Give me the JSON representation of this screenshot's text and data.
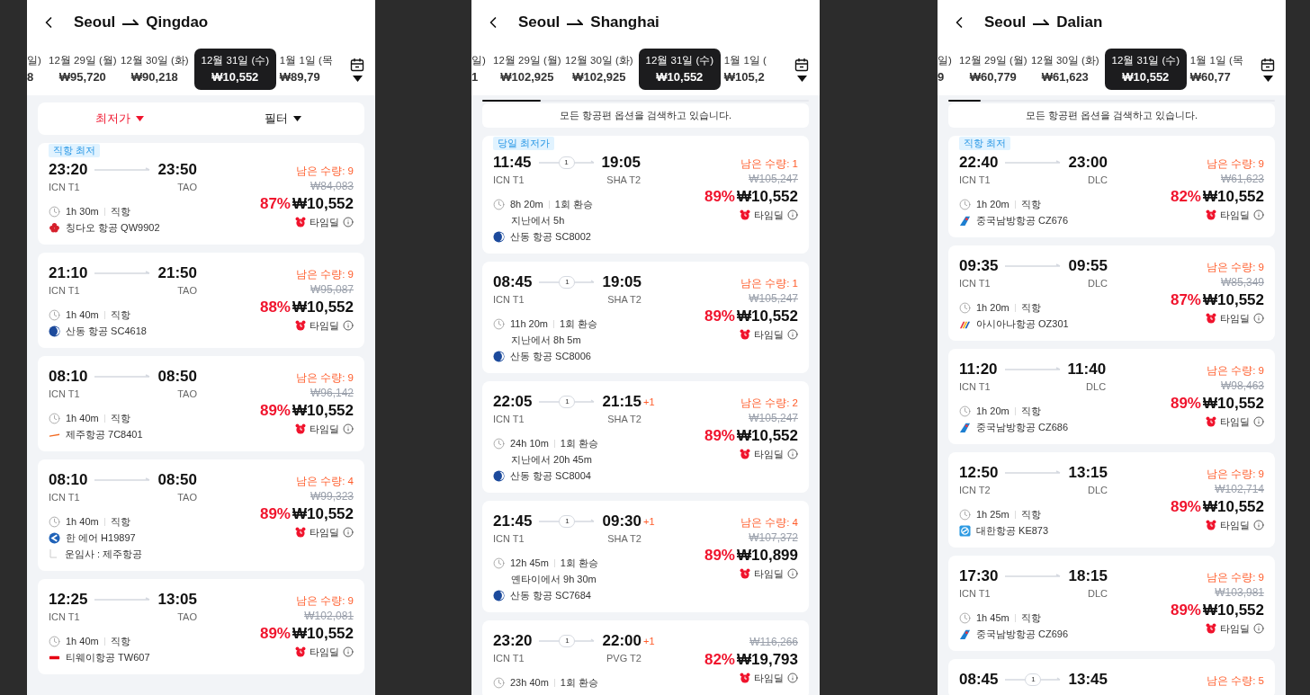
{
  "panels": [
    {
      "title": {
        "from": "Seoul",
        "to": "Qingdao"
      },
      "dates": [
        {
          "day": "일)",
          "price": "8",
          "selected": false
        },
        {
          "day": "12월 29일 (월)",
          "price": "₩95,720",
          "selected": false
        },
        {
          "day": "12월 30일 (화)",
          "price": "₩90,218",
          "selected": false
        },
        {
          "day": "12월 31일 (수)",
          "price": "₩10,552",
          "selected": true
        },
        {
          "day": "1월 1일 (목",
          "price": "₩89,79",
          "selected": false
        }
      ],
      "sort_bar": [
        {
          "label": "최저가",
          "active": true
        },
        {
          "label": "필터",
          "active": false
        }
      ],
      "flights": [
        {
          "badge": "직항 최저",
          "depart": "23:20",
          "arrive": "23:50",
          "from": "ICN T1",
          "to": "TAO",
          "duration": "1h 30m",
          "type": "직항",
          "logo": {
            "kind": "flower"
          },
          "airline": "칭다오 항공 QW9902",
          "remaining": "남은 수량: 9",
          "original": "₩84,083",
          "discount": "87%",
          "price": "₩10,552",
          "deal": "타임딜"
        },
        {
          "depart": "21:10",
          "arrive": "21:50",
          "from": "ICN T1",
          "to": "TAO",
          "duration": "1h 40m",
          "type": "직항",
          "logo": {
            "kind": "crescent"
          },
          "airline": "산동 항공 SC4618",
          "remaining": "남은 수량: 9",
          "original": "₩95,087",
          "discount": "88%",
          "price": "₩10,552",
          "deal": "타임딜"
        },
        {
          "depart": "08:10",
          "arrive": "08:50",
          "from": "ICN T1",
          "to": "TAO",
          "duration": "1h 40m",
          "type": "직항",
          "logo": {
            "kind": "swoosh"
          },
          "airline": "제주항공 7C8401",
          "remaining": "남은 수량: 9",
          "original": "₩96,142",
          "discount": "89%",
          "price": "₩10,552",
          "deal": "타임딜"
        },
        {
          "depart": "08:10",
          "arrive": "08:50",
          "from": "ICN T1",
          "to": "TAO",
          "duration": "1h 40m",
          "type": "직항",
          "logo": {
            "kind": "chevron"
          },
          "airline": "한 에어 H19897",
          "operator": "운임사 : 제주항공",
          "remaining": "남은 수량: 4",
          "original": "₩99,323",
          "discount": "89%",
          "price": "₩10,552",
          "deal": "타임딜"
        },
        {
          "depart": "12:25",
          "arrive": "13:05",
          "from": "ICN T1",
          "to": "TAO",
          "duration": "1h 40m",
          "type": "직항",
          "logo": {
            "kind": "tag"
          },
          "airline": "티웨이항공 TW607",
          "remaining": "남은 수량: 9",
          "original": "₩102,081",
          "discount": "89%",
          "price": "₩10,552",
          "deal": "타임딜"
        }
      ]
    },
    {
      "title": {
        "from": "Seoul",
        "to": "Shanghai"
      },
      "dates": [
        {
          "day": "일)",
          "price": "1",
          "selected": false
        },
        {
          "day": "12월 29일 (월)",
          "price": "₩102,925",
          "selected": false
        },
        {
          "day": "12월 30일 (화)",
          "price": "₩102,925",
          "selected": false
        },
        {
          "day": "12월 31일 (수)",
          "price": "₩10,552",
          "selected": true
        },
        {
          "day": "1월 1일 (",
          "price": "₩105,2",
          "selected": false
        }
      ],
      "status": {
        "text": "모든 항공편 옵션을 검색하고 있습니다.",
        "level": 0.18
      },
      "flights": [
        {
          "badge": "당일 최저가",
          "depart": "11:45",
          "stops": "1",
          "arrive": "19:05",
          "from": "ICN T1",
          "to": "SHA T2",
          "duration": "8h 20m",
          "type": "1회 환승",
          "layover": "지난에서 5h",
          "logo": {
            "kind": "crescent"
          },
          "airline": "산동 항공 SC8002",
          "remaining": "남은 수량: 1",
          "original": "₩105,247",
          "discount": "89%",
          "price": "₩10,552",
          "deal": "타임딜"
        },
        {
          "depart": "08:45",
          "stops": "1",
          "arrive": "19:05",
          "from": "ICN T1",
          "to": "SHA T2",
          "duration": "11h 20m",
          "type": "1회 환승",
          "layover": "지난에서 8h 5m",
          "logo": {
            "kind": "crescent"
          },
          "airline": "산동 항공 SC8006",
          "remaining": "남은 수량: 1",
          "original": "₩105,247",
          "discount": "89%",
          "price": "₩10,552",
          "deal": "타임딜"
        },
        {
          "depart": "22:05",
          "stops": "1",
          "arrive": "21:15",
          "next_day": "+1",
          "from": "ICN T1",
          "to": "SHA T2",
          "duration": "24h 10m",
          "type": "1회 환승",
          "layover": "지난에서 20h 45m",
          "logo": {
            "kind": "crescent"
          },
          "airline": "산동 항공 SC8004",
          "remaining": "남은 수량: 2",
          "original": "₩105,247",
          "discount": "89%",
          "price": "₩10,552",
          "deal": "타임딜"
        },
        {
          "depart": "21:45",
          "stops": "1",
          "arrive": "09:30",
          "next_day": "+1",
          "from": "ICN T1",
          "to": "SHA T2",
          "duration": "12h 45m",
          "type": "1회 환승",
          "layover": "옌타이에서 9h 30m",
          "logo": {
            "kind": "crescent"
          },
          "airline": "산동 항공 SC7684",
          "remaining": "남은 수량: 4",
          "original": "₩107,372",
          "discount": "89%",
          "price": "₩10,899",
          "deal": "타임딜"
        },
        {
          "depart": "23:20",
          "stops": "1",
          "arrive": "22:00",
          "next_day": "+1",
          "from": "ICN T1",
          "to": "PVG T2",
          "duration": "23h 40m",
          "type": "1회 환승",
          "original": "₩116,266",
          "discount": "82%",
          "price": "₩19,793",
          "deal": "타임딜"
        }
      ]
    },
    {
      "title": {
        "from": "Seoul",
        "to": "Dalian"
      },
      "dates": [
        {
          "day": "일)",
          "price": "9",
          "selected": false
        },
        {
          "day": "12월 29일 (월)",
          "price": "₩60,779",
          "selected": false
        },
        {
          "day": "12월 30일 (화)",
          "price": "₩61,623",
          "selected": false
        },
        {
          "day": "12월 31일 (수)",
          "price": "₩10,552",
          "selected": true
        },
        {
          "day": "1월 1일 (목",
          "price": "₩60,77",
          "selected": false
        }
      ],
      "status": {
        "text": "모든 항공편 옵션을 검색하고 있습니다.",
        "level": 0.1
      },
      "flights": [
        {
          "badge": "직항 최저",
          "depart": "22:40",
          "arrive": "23:00",
          "from": "ICN T1",
          "to": "DLC",
          "duration": "1h 20m",
          "type": "직항",
          "logo": {
            "kind": "tail"
          },
          "airline": "중국남방항공 CZ676",
          "remaining": "남은 수량: 9",
          "original": "₩61,623",
          "discount": "82%",
          "price": "₩10,552",
          "deal": "타임딜"
        },
        {
          "depart": "09:35",
          "arrive": "09:55",
          "from": "ICN T1",
          "to": "DLC",
          "duration": "1h 20m",
          "type": "직항",
          "logo": {
            "kind": "stripes"
          },
          "airline": "아시아나항공 OZ301",
          "remaining": "남은 수량: 9",
          "original": "₩85,349",
          "discount": "87%",
          "price": "₩10,552",
          "deal": "타임딜"
        },
        {
          "depart": "11:20",
          "arrive": "11:40",
          "from": "ICN T1",
          "to": "DLC",
          "duration": "1h 20m",
          "type": "직항",
          "logo": {
            "kind": "tail"
          },
          "airline": "중국남방항공 CZ686",
          "remaining": "남은 수량: 9",
          "original": "₩98,463",
          "discount": "89%",
          "price": "₩10,552",
          "deal": "타임딜"
        },
        {
          "depart": "12:50",
          "arrive": "13:15",
          "from": "ICN T2",
          "to": "DLC",
          "duration": "1h 25m",
          "type": "직항",
          "logo": {
            "kind": "swirl"
          },
          "airline": "대한항공 KE873",
          "remaining": "남은 수량: 9",
          "original": "₩102,714",
          "discount": "89%",
          "price": "₩10,552",
          "deal": "타임딜"
        },
        {
          "depart": "17:30",
          "arrive": "18:15",
          "from": "ICN T1",
          "to": "DLC",
          "duration": "1h 45m",
          "type": "직항",
          "logo": {
            "kind": "tail"
          },
          "airline": "중국남방항공 CZ696",
          "remaining": "남은 수량: 9",
          "original": "₩103,981",
          "discount": "89%",
          "price": "₩10,552",
          "deal": "타임딜"
        },
        {
          "depart": "08:45",
          "stops": "1",
          "arrive": "13:45",
          "remaining": "남은 수량: 5"
        }
      ]
    }
  ]
}
